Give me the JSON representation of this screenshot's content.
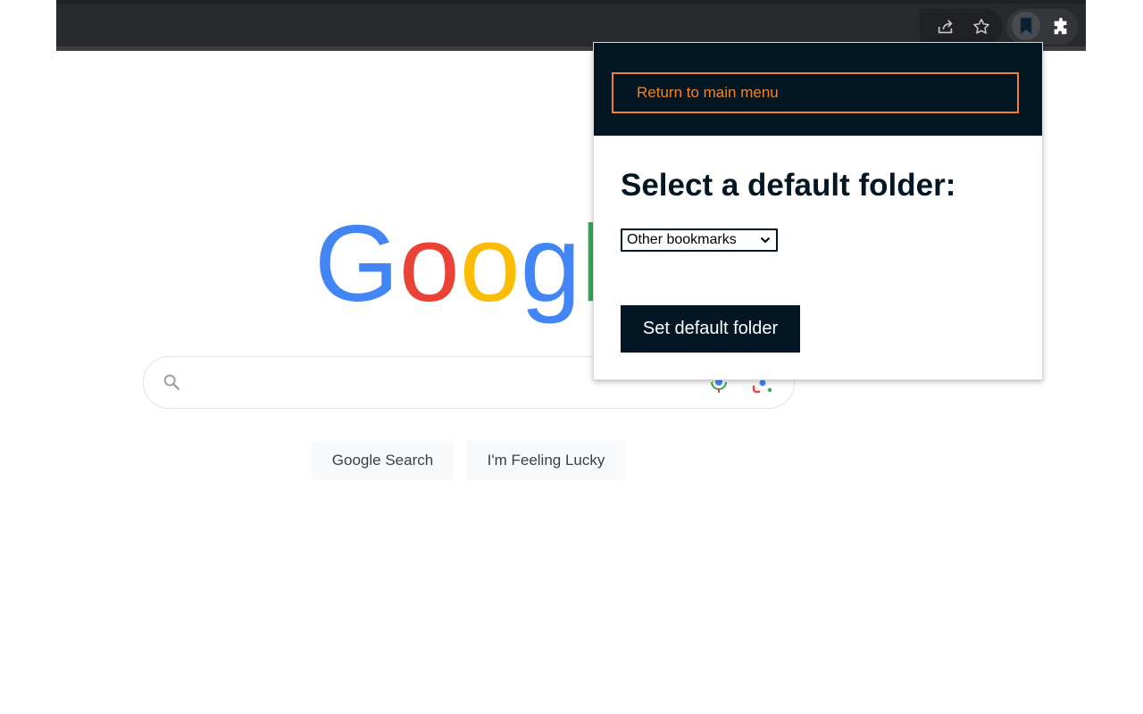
{
  "browser": {
    "toolbar_icons": [
      "share-icon",
      "star-icon",
      "bookmark-extension-icon",
      "puzzle-extensions-icon"
    ]
  },
  "google": {
    "logo_text": "Google",
    "buttons": {
      "search": "Google Search",
      "lucky": "I'm Feeling Lucky"
    },
    "search_value": ""
  },
  "popup": {
    "return_label": "Return to main menu",
    "title": "Select a default folder:",
    "folder_selected": "Other bookmarks",
    "set_button_label": "Set default folder",
    "colors": {
      "header_bg": "#031624",
      "accent_orange": "#f58220",
      "button_bg": "#031624"
    }
  }
}
